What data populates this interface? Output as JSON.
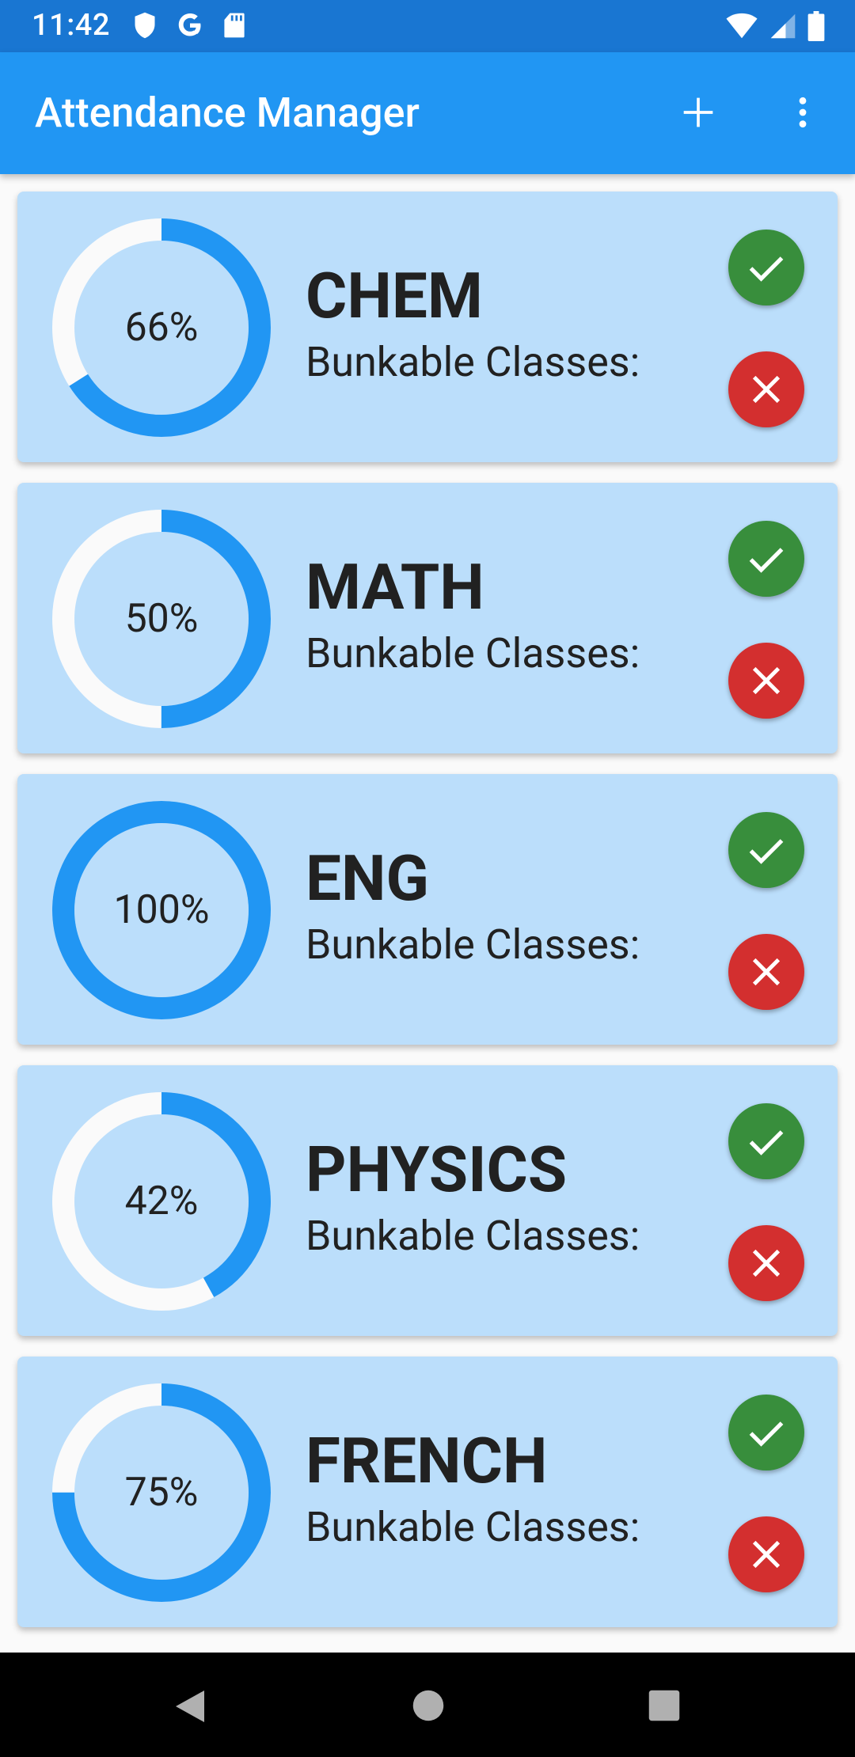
{
  "status_bar": {
    "time": "11:42",
    "left_icons": [
      "shield-icon",
      "google-icon",
      "sd-card-icon"
    ],
    "right_icons": [
      "wifi-icon",
      "signal-icon",
      "battery-icon"
    ]
  },
  "app_bar": {
    "title": "Attendance Manager",
    "actions": [
      "add-icon",
      "more-vert-icon"
    ]
  },
  "colors": {
    "status_bar": "#1976d2",
    "app_bar": "#2196f3",
    "card_bg": "#bbdefb",
    "ring_progress": "#2196f3",
    "ring_track": "#fafafa",
    "present": "#388e3c",
    "absent": "#d32f2f"
  },
  "subjects": [
    {
      "name": "CHEM",
      "percent_label": "66%",
      "percent": 0.66,
      "bunk_label": "Bunkable Classes:"
    },
    {
      "name": "MATH",
      "percent_label": "50%",
      "percent": 0.5,
      "bunk_label": "Bunkable Classes:"
    },
    {
      "name": "ENG",
      "percent_label": "100%",
      "percent": 1.0,
      "bunk_label": "Bunkable Classes:"
    },
    {
      "name": "PHYSICS",
      "percent_label": "42%",
      "percent": 0.42,
      "bunk_label": "Bunkable Classes:"
    },
    {
      "name": "FRENCH",
      "percent_label": "75%",
      "percent": 0.75,
      "bunk_label": "Bunkable Classes:"
    }
  ],
  "nav_bar": {
    "buttons": [
      "back-icon",
      "home-icon",
      "recents-icon"
    ]
  }
}
